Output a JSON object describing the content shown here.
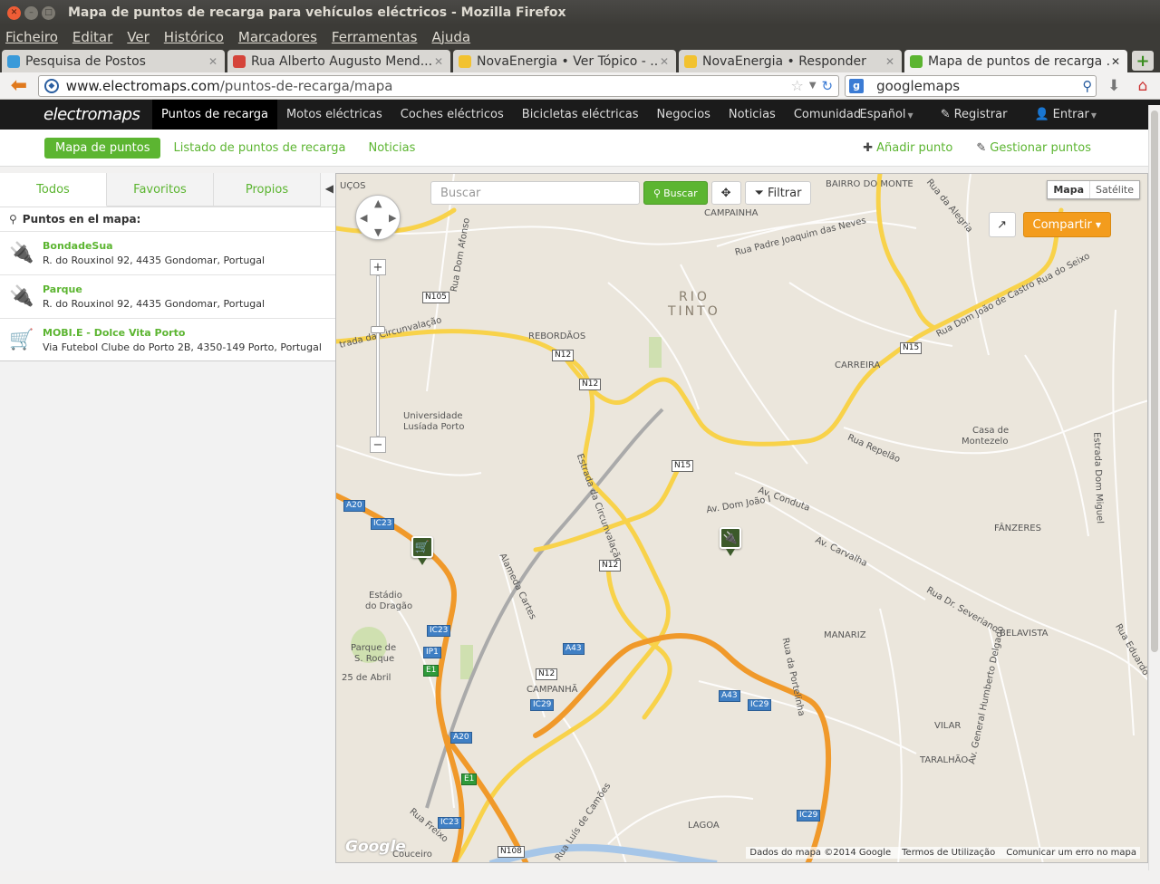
{
  "window": {
    "title": "Mapa de puntos de recarga para vehículos eléctricos - Mozilla Firefox"
  },
  "menu": [
    "Ficheiro",
    "Editar",
    "Ver",
    "Histórico",
    "Marcadores",
    "Ferramentas",
    "Ajuda"
  ],
  "tabs": [
    {
      "label": "Pesquisa de Postos",
      "icon": "phone-icon",
      "color": "#3a9ad9"
    },
    {
      "label": "Rua Alberto Augusto Mend...",
      "icon": "maps-icon",
      "color": "#d5443a"
    },
    {
      "label": "NovaEnergia • Ver Tópico - ...",
      "icon": "forum-icon",
      "color": "#f2c230"
    },
    {
      "label": "NovaEnergia • Responder",
      "icon": "forum-icon",
      "color": "#f2c230"
    },
    {
      "label": "Mapa de puntos de recarga ...",
      "icon": "electromaps-icon",
      "color": "#5cb531"
    }
  ],
  "urlbar": {
    "domain": "www.electromaps.com",
    "path": "/puntos-de-recarga/mapa"
  },
  "searchbar": {
    "engine": "g",
    "value": "googlemaps"
  },
  "site": {
    "logo": "electromaps",
    "nav": [
      "Puntos de recarga",
      "Motos eléctricas",
      "Coches eléctricos",
      "Bicicletas eléctricas",
      "Negocios",
      "Noticias",
      "Comunidad"
    ],
    "language": "Español",
    "register": "Registrar",
    "login": "Entrar"
  },
  "subnav": {
    "active": "Mapa de puntos",
    "links": [
      "Listado de puntos de recarga",
      "Noticias"
    ],
    "add_point": "Añadir punto",
    "manage_points": "Gestionar puntos"
  },
  "panel": {
    "tabs": [
      "Todos",
      "Favoritos",
      "Propios"
    ],
    "heading": "Puntos en el mapa:",
    "points": [
      {
        "name": "BondadeSua",
        "address": "R. do Rouxinol 92, 4435 Gondomar, Portugal",
        "icon": "plug-icon"
      },
      {
        "name": "Parque",
        "address": "R. do Rouxinol 92, 4435 Gondomar, Portugal",
        "icon": "plug-icon"
      },
      {
        "name": "MOBI.E - Dolce Vita Porto",
        "address": "Via Futebol Clube do Porto 2B, 4350-149 Porto, Portugal",
        "icon": "cart-icon"
      }
    ]
  },
  "map": {
    "search_placeholder": "Buscar",
    "search_button": "Buscar",
    "filter_button": "Filtrar",
    "type_map": "Mapa",
    "type_satellite": "Satélite",
    "share_button": "Compartir",
    "google": "Google",
    "attribution": [
      "Dados do mapa ©2014 Google",
      "Termos de Utilização",
      "Comunicar um erro no mapa"
    ],
    "labels": [
      "UÇOS",
      "CAMPAINHA",
      "BAIRRO DO MONTE",
      "Rua Padre Joaquim das Neves",
      "RIO",
      "TINTO",
      "Rua Dom Afonso",
      "REBORDÃOS",
      "trada da Circunvalação",
      "Universidade",
      "Lusíada Porto",
      "CARREIRA",
      "Rua Dom João de Castro",
      "Casa de",
      "Montezelo",
      "Rua Repelão",
      "Av. Dom João I",
      "Av. Conduta",
      "FÂNZERES",
      "Av. Carvalha",
      "Rua Dr. Severiano",
      "Estrada da Circunvalação",
      "Alameda Cartes",
      "Estádio",
      "do Dragão",
      "Parque de",
      "S. Roque",
      "25 de Abril",
      "CAMPANHÃ",
      "MANARIZ",
      "BELAVISTA",
      "Rua da Portelinha",
      "VILAR",
      "TARALHÃO",
      "Av. General Humberto Delgado",
      "LAGOA",
      "Rua Luís de Camões",
      "Rua Freixo",
      "Couceiro",
      "Estrada Dom Miguel",
      "Rua do Seixo",
      "Rua da Alegria",
      "Rua Eduardo"
    ],
    "shields": [
      "N105",
      "N12",
      "N12",
      "N15",
      "N15",
      "N12",
      "N12",
      "A20",
      "IC23",
      "IC23",
      "IP1",
      "E1",
      "A43",
      "A43",
      "IC29",
      "IC29",
      "A20",
      "E1",
      "IC23",
      "N108",
      "IC29"
    ]
  },
  "colors": {
    "brand_green": "#5cb531",
    "header_dark": "#1b1b1b",
    "share_orange": "#f39c1d",
    "road_yellow": "#f8d24a",
    "highway_orange": "#f0992a"
  }
}
